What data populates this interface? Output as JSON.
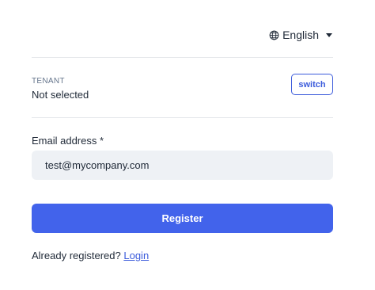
{
  "language": {
    "label": "English",
    "icon": "globe-icon"
  },
  "tenant": {
    "label": "TENANT",
    "value": "Not selected",
    "switch_label": "switch"
  },
  "email": {
    "label": "Email address *",
    "value": "test@mycompany.com"
  },
  "register": {
    "label": "Register"
  },
  "footer": {
    "text": "Already registered?",
    "link": "Login"
  },
  "colors": {
    "accent": "#4263eb",
    "input_bg": "#eef1f5",
    "divider": "#e5e7eb"
  }
}
